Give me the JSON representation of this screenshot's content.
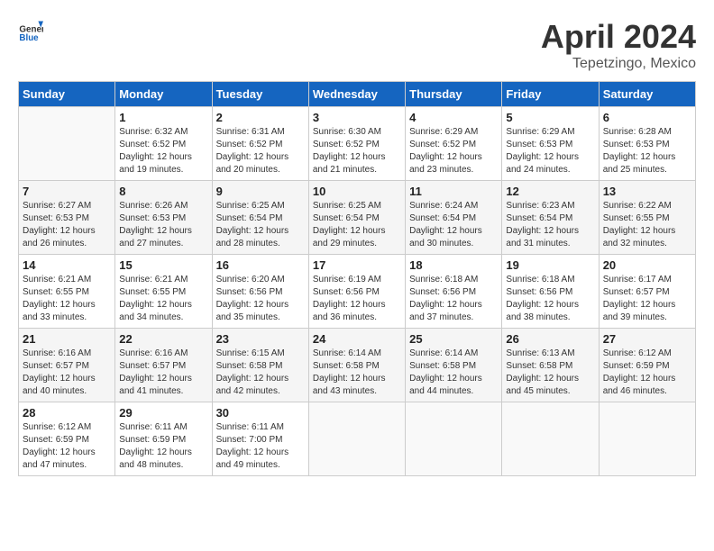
{
  "header": {
    "logo_general": "General",
    "logo_blue": "Blue",
    "month": "April 2024",
    "location": "Tepetzingo, Mexico"
  },
  "weekdays": [
    "Sunday",
    "Monday",
    "Tuesday",
    "Wednesday",
    "Thursday",
    "Friday",
    "Saturday"
  ],
  "weeks": [
    [
      {
        "day": "",
        "empty": true
      },
      {
        "day": "1",
        "sunrise": "6:32 AM",
        "sunset": "6:52 PM",
        "daylight": "12 hours and 19 minutes."
      },
      {
        "day": "2",
        "sunrise": "6:31 AM",
        "sunset": "6:52 PM",
        "daylight": "12 hours and 20 minutes."
      },
      {
        "day": "3",
        "sunrise": "6:30 AM",
        "sunset": "6:52 PM",
        "daylight": "12 hours and 21 minutes."
      },
      {
        "day": "4",
        "sunrise": "6:29 AM",
        "sunset": "6:52 PM",
        "daylight": "12 hours and 23 minutes."
      },
      {
        "day": "5",
        "sunrise": "6:29 AM",
        "sunset": "6:53 PM",
        "daylight": "12 hours and 24 minutes."
      },
      {
        "day": "6",
        "sunrise": "6:28 AM",
        "sunset": "6:53 PM",
        "daylight": "12 hours and 25 minutes."
      }
    ],
    [
      {
        "day": "7",
        "sunrise": "6:27 AM",
        "sunset": "6:53 PM",
        "daylight": "12 hours and 26 minutes."
      },
      {
        "day": "8",
        "sunrise": "6:26 AM",
        "sunset": "6:53 PM",
        "daylight": "12 hours and 27 minutes."
      },
      {
        "day": "9",
        "sunrise": "6:25 AM",
        "sunset": "6:54 PM",
        "daylight": "12 hours and 28 minutes."
      },
      {
        "day": "10",
        "sunrise": "6:25 AM",
        "sunset": "6:54 PM",
        "daylight": "12 hours and 29 minutes."
      },
      {
        "day": "11",
        "sunrise": "6:24 AM",
        "sunset": "6:54 PM",
        "daylight": "12 hours and 30 minutes."
      },
      {
        "day": "12",
        "sunrise": "6:23 AM",
        "sunset": "6:54 PM",
        "daylight": "12 hours and 31 minutes."
      },
      {
        "day": "13",
        "sunrise": "6:22 AM",
        "sunset": "6:55 PM",
        "daylight": "12 hours and 32 minutes."
      }
    ],
    [
      {
        "day": "14",
        "sunrise": "6:21 AM",
        "sunset": "6:55 PM",
        "daylight": "12 hours and 33 minutes."
      },
      {
        "day": "15",
        "sunrise": "6:21 AM",
        "sunset": "6:55 PM",
        "daylight": "12 hours and 34 minutes."
      },
      {
        "day": "16",
        "sunrise": "6:20 AM",
        "sunset": "6:56 PM",
        "daylight": "12 hours and 35 minutes."
      },
      {
        "day": "17",
        "sunrise": "6:19 AM",
        "sunset": "6:56 PM",
        "daylight": "12 hours and 36 minutes."
      },
      {
        "day": "18",
        "sunrise": "6:18 AM",
        "sunset": "6:56 PM",
        "daylight": "12 hours and 37 minutes."
      },
      {
        "day": "19",
        "sunrise": "6:18 AM",
        "sunset": "6:56 PM",
        "daylight": "12 hours and 38 minutes."
      },
      {
        "day": "20",
        "sunrise": "6:17 AM",
        "sunset": "6:57 PM",
        "daylight": "12 hours and 39 minutes."
      }
    ],
    [
      {
        "day": "21",
        "sunrise": "6:16 AM",
        "sunset": "6:57 PM",
        "daylight": "12 hours and 40 minutes."
      },
      {
        "day": "22",
        "sunrise": "6:16 AM",
        "sunset": "6:57 PM",
        "daylight": "12 hours and 41 minutes."
      },
      {
        "day": "23",
        "sunrise": "6:15 AM",
        "sunset": "6:58 PM",
        "daylight": "12 hours and 42 minutes."
      },
      {
        "day": "24",
        "sunrise": "6:14 AM",
        "sunset": "6:58 PM",
        "daylight": "12 hours and 43 minutes."
      },
      {
        "day": "25",
        "sunrise": "6:14 AM",
        "sunset": "6:58 PM",
        "daylight": "12 hours and 44 minutes."
      },
      {
        "day": "26",
        "sunrise": "6:13 AM",
        "sunset": "6:58 PM",
        "daylight": "12 hours and 45 minutes."
      },
      {
        "day": "27",
        "sunrise": "6:12 AM",
        "sunset": "6:59 PM",
        "daylight": "12 hours and 46 minutes."
      }
    ],
    [
      {
        "day": "28",
        "sunrise": "6:12 AM",
        "sunset": "6:59 PM",
        "daylight": "12 hours and 47 minutes."
      },
      {
        "day": "29",
        "sunrise": "6:11 AM",
        "sunset": "6:59 PM",
        "daylight": "12 hours and 48 minutes."
      },
      {
        "day": "30",
        "sunrise": "6:11 AM",
        "sunset": "7:00 PM",
        "daylight": "12 hours and 49 minutes."
      },
      {
        "day": "",
        "empty": true
      },
      {
        "day": "",
        "empty": true
      },
      {
        "day": "",
        "empty": true
      },
      {
        "day": "",
        "empty": true
      }
    ]
  ]
}
